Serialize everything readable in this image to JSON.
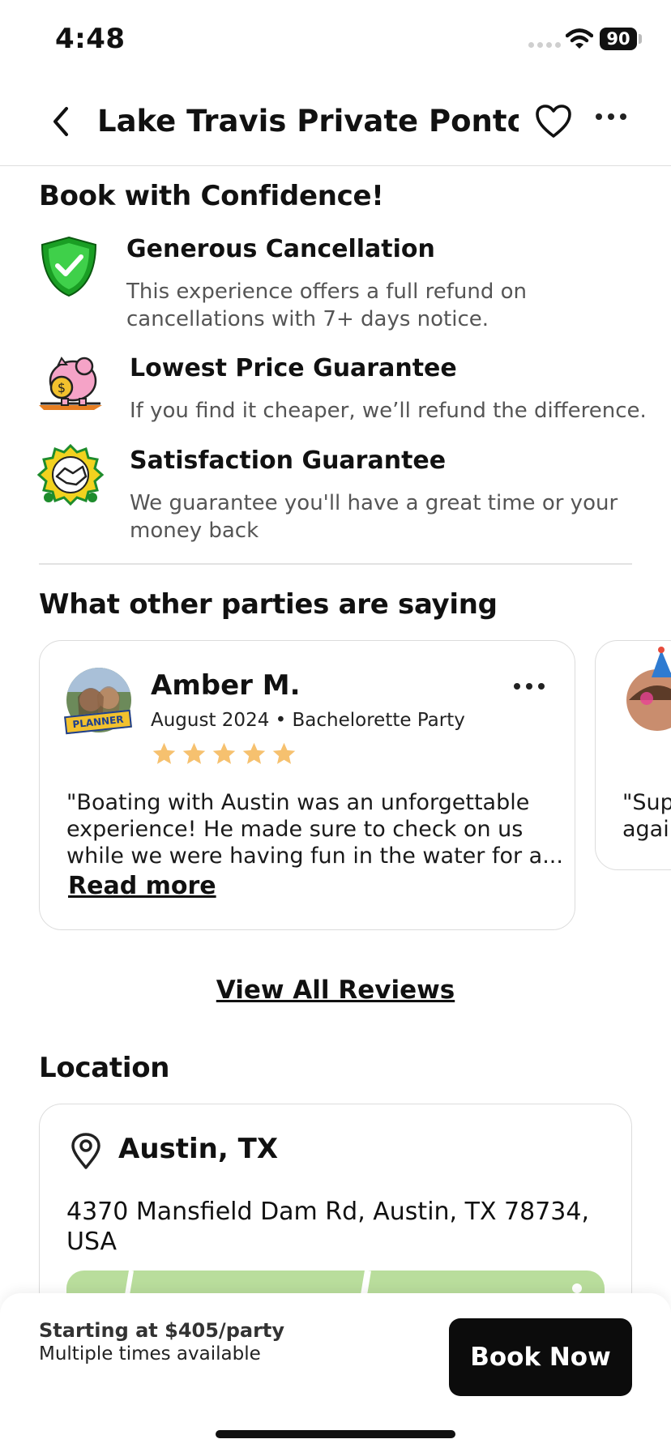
{
  "status_bar": {
    "time": "4:48",
    "battery": "90"
  },
  "nav": {
    "title": "Lake Travis Private Pontoon P..."
  },
  "confidence": {
    "heading": "Book with Confidence!",
    "features": [
      {
        "title": "Generous Cancellation",
        "desc1": "This experience offers a full refund on",
        "desc2": "cancellations with 7+ days notice."
      },
      {
        "title": "Lowest Price Guarantee",
        "desc1": "If you find it cheaper, we’ll refund the difference."
      },
      {
        "title": "Satisfaction Guarantee",
        "desc1": "We guarantee you'll have a great time or your",
        "desc2": "money back"
      }
    ]
  },
  "reviews": {
    "heading": "What other parties are saying",
    "items": [
      {
        "name": "Amber M.",
        "badge": "PLANNER",
        "meta": "August 2024 • Bachelorette Party",
        "rating": 5,
        "line1": "\"Boating with Austin was an unforgettable",
        "line2": "experience! He made sure to check on us",
        "line3": "while we were having fun in the water for a...",
        "read_more": "Read more"
      },
      {
        "line1": "\"Sup",
        "line2": "agai"
      }
    ],
    "view_all": "View All Reviews"
  },
  "location": {
    "heading": "Location",
    "city": "Austin, TX",
    "address1": "4370 Mansfield Dam Rd, Austin, TX 78734,",
    "address2": "USA"
  },
  "booking": {
    "price": "Starting at $405/party",
    "availability": "Multiple times available",
    "button": "Book Now"
  },
  "colors": {
    "star": "#f6c16f",
    "shield": "#1fb32a",
    "map": "#b9dd9c",
    "button": "#0c0c0c"
  }
}
